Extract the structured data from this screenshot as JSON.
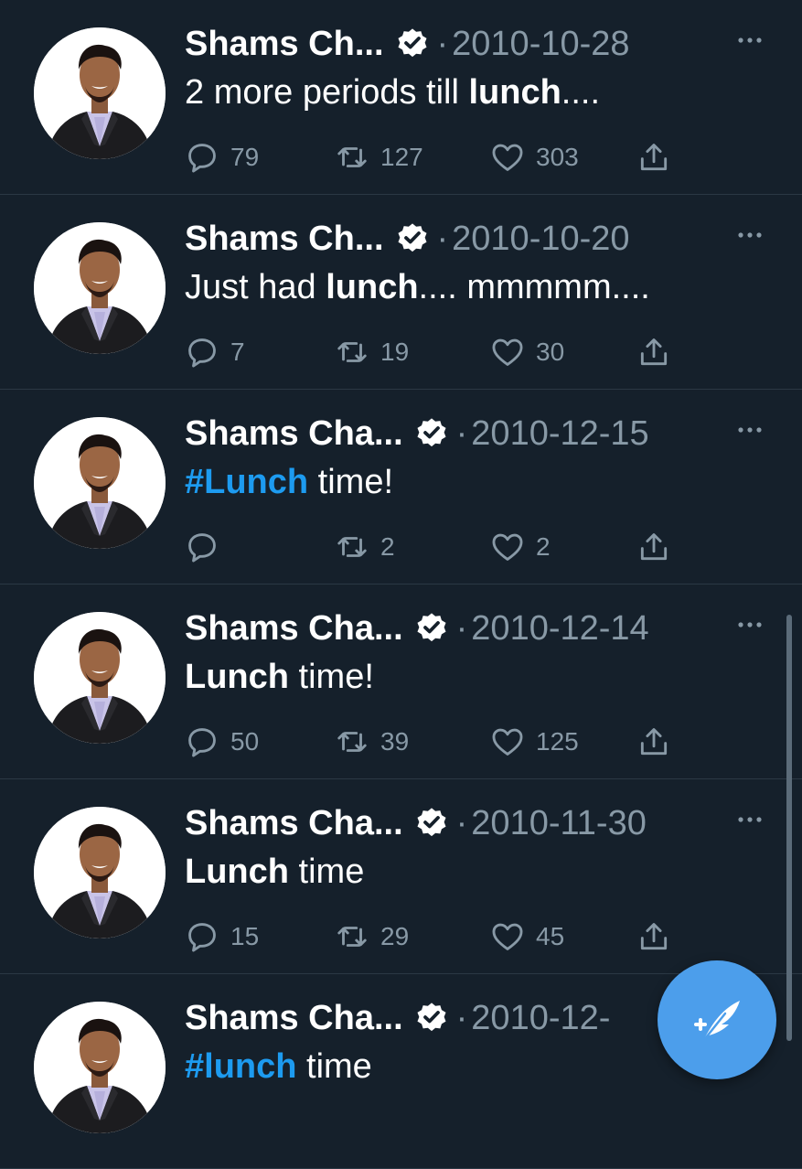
{
  "colors": {
    "background": "#15202b",
    "divider": "#2b3844",
    "secondary_text": "#8899a6",
    "hashtag": "#1d9bf0",
    "fab": "#4c9eeb"
  },
  "tweets": [
    {
      "name": "Shams Ch...",
      "separator": "·",
      "date": "2010-10-28",
      "text_parts": [
        {
          "t": "2 more periods till ",
          "s": "normal"
        },
        {
          "t": "lunch",
          "s": "bold"
        },
        {
          "t": "....",
          "s": "normal"
        }
      ],
      "replies": "79",
      "retweets": "127",
      "likes": "303"
    },
    {
      "name": "Shams Ch...",
      "separator": "·",
      "date": "2010-10-20",
      "text_parts": [
        {
          "t": "Just had ",
          "s": "normal"
        },
        {
          "t": "lunch",
          "s": "bold"
        },
        {
          "t": ".... mmmmm....",
          "s": "normal"
        }
      ],
      "replies": "7",
      "retweets": "19",
      "likes": "30"
    },
    {
      "name": "Shams Cha...",
      "separator": "·",
      "date": "2010-12-15",
      "text_parts": [
        {
          "t": "#Lunch",
          "s": "hashtag"
        },
        {
          "t": " time!",
          "s": "normal"
        }
      ],
      "replies": "",
      "retweets": "2",
      "likes": "2"
    },
    {
      "name": "Shams Cha...",
      "separator": "·",
      "date": "2010-12-14",
      "text_parts": [
        {
          "t": "Lunch",
          "s": "bold"
        },
        {
          "t": " time!",
          "s": "normal"
        }
      ],
      "replies": "50",
      "retweets": "39",
      "likes": "125"
    },
    {
      "name": "Shams Cha...",
      "separator": "·",
      "date": "2010-11-30",
      "text_parts": [
        {
          "t": "Lunch",
          "s": "bold"
        },
        {
          "t": " time",
          "s": "normal"
        }
      ],
      "replies": "15",
      "retweets": "29",
      "likes": "45"
    },
    {
      "name": "Shams Cha...",
      "separator": "·",
      "date": "2010-12-",
      "text_parts": [
        {
          "t": "#lunch",
          "s": "hashtag"
        },
        {
          "t": " time",
          "s": "normal"
        }
      ],
      "replies": "",
      "retweets": "",
      "likes": ""
    }
  ],
  "icons": {
    "verified": "verified-badge-icon",
    "more": "more-options-icon",
    "reply": "reply-bubble-icon",
    "retweet": "retweet-icon",
    "like": "heart-icon",
    "share": "share-icon",
    "compose": "compose-tweet-icon"
  }
}
